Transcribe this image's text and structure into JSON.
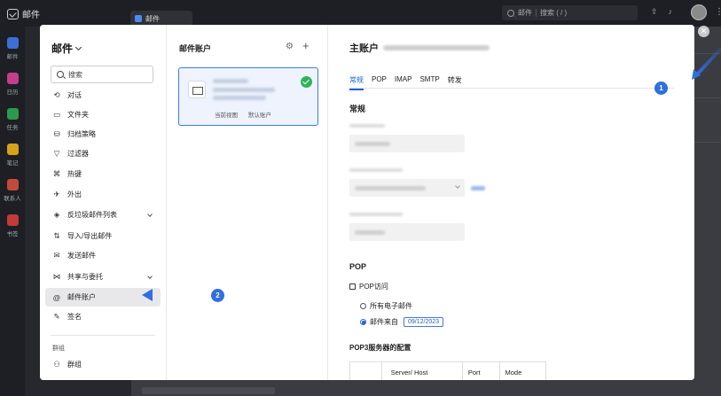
{
  "app": {
    "title": "邮件",
    "tab_label": "邮件",
    "search_scope": "邮件",
    "search_placeholder": "搜索 ( / )"
  },
  "rail": [
    {
      "label": "邮件",
      "color": "#3b6fd8"
    },
    {
      "label": "日历",
      "color": "#c2408a"
    },
    {
      "label": "任务",
      "color": "#2c9a4c"
    },
    {
      "label": "笔记",
      "color": "#d8a21a"
    },
    {
      "label": "联系人",
      "color": "#c24a3a"
    },
    {
      "label": "书签",
      "color": "#c23a3a"
    }
  ],
  "nav": {
    "title": "邮件",
    "search_placeholder": "搜索",
    "items": [
      {
        "label": "对话",
        "icon": "conversation-icon",
        "glyph": "⟲"
      },
      {
        "label": "文件夹",
        "icon": "folder-icon",
        "glyph": "▭"
      },
      {
        "label": "归档策略",
        "icon": "archive-icon",
        "glyph": "⛁"
      },
      {
        "label": "过滤器",
        "icon": "filter-icon",
        "glyph": "▽"
      },
      {
        "label": "热键",
        "icon": "hotkey-icon",
        "glyph": "⌘"
      },
      {
        "label": "外出",
        "icon": "out-of-office-icon",
        "glyph": "✈"
      },
      {
        "label": "反垃圾邮件列表",
        "icon": "spam-shield-icon",
        "glyph": "◈",
        "expandable": true
      },
      {
        "label": "导入/导出邮件",
        "icon": "import-export-icon",
        "glyph": "⇅"
      },
      {
        "label": "发送邮件",
        "icon": "send-mail-icon",
        "glyph": "✉"
      },
      {
        "label": "共享与委托",
        "icon": "share-icon",
        "glyph": "⋈",
        "expandable": true
      },
      {
        "label": "邮件账户",
        "icon": "at-sign-icon",
        "glyph": "@",
        "active": true
      },
      {
        "label": "签名",
        "icon": "signature-icon",
        "glyph": "✎"
      }
    ],
    "group_heading": "群组",
    "group_item": {
      "label": "群组",
      "icon": "group-icon",
      "glyph": "⚇"
    }
  },
  "accounts": {
    "title": "邮件账户",
    "card_tags": [
      "当前视图",
      "默认账户"
    ]
  },
  "detail": {
    "title": "主账户",
    "tabs": [
      "常规",
      "POP",
      "IMAP",
      "SMTP",
      "转发"
    ],
    "active_tab": "常规",
    "section_general": "常规",
    "section_pop": "POP",
    "pop_access_label": "POP访问",
    "all_mail_label": "所有电子邮件",
    "mail_from_label": "邮件来自",
    "mail_from_date": "09/12/2023",
    "pop3_config_title": "POP3服务器的配置",
    "table_headers": [
      "",
      "Server/ Host",
      "Port",
      "Mode"
    ]
  },
  "annotations": {
    "badge_1": "1",
    "badge_2": "2",
    "color": "#2f6fe0"
  }
}
